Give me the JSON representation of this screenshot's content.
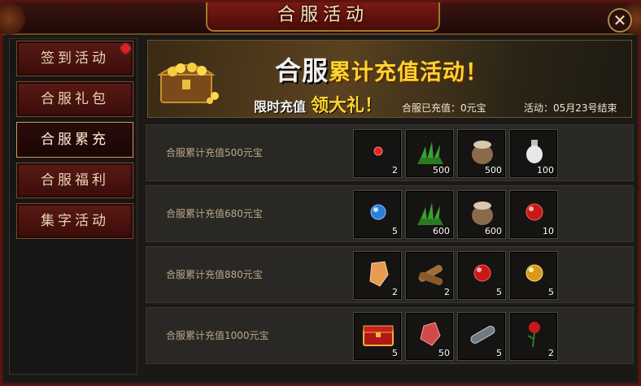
{
  "window": {
    "title": "合服活动",
    "close_label": "✕"
  },
  "sidebar": {
    "items": [
      {
        "label": "签到活动",
        "has_notice": true,
        "active": false
      },
      {
        "label": "合服礼包",
        "has_notice": false,
        "active": false
      },
      {
        "label": "合服累充",
        "has_notice": false,
        "active": true
      },
      {
        "label": "合服福利",
        "has_notice": false,
        "active": false
      },
      {
        "label": "集字活动",
        "has_notice": false,
        "active": false
      }
    ]
  },
  "banner": {
    "title_part1": "合服",
    "title_part2": "累计充值活动！",
    "subtitle_part1": "限时充值",
    "subtitle_part2": "领大礼！",
    "recharged_text": "合服已充值：0元宝",
    "end_text": "活动：05月23号结束"
  },
  "tiers": [
    {
      "label": "合服累计充值500元宝",
      "rewards": [
        {
          "icon": "red-gem-icon",
          "qty": "2"
        },
        {
          "icon": "herb-icon",
          "qty": "500"
        },
        {
          "icon": "sack-icon",
          "qty": "500"
        },
        {
          "icon": "white-potion-icon",
          "qty": "100"
        }
      ]
    },
    {
      "label": "合服累计充值680元宝",
      "rewards": [
        {
          "icon": "blue-orb-icon",
          "qty": "5"
        },
        {
          "icon": "herb-icon",
          "qty": "600"
        },
        {
          "icon": "sack-icon",
          "qty": "600"
        },
        {
          "icon": "red-orb-icon",
          "qty": "10"
        }
      ]
    },
    {
      "label": "合服累计充值880元宝",
      "rewards": [
        {
          "icon": "amber-crystal-icon",
          "qty": "2"
        },
        {
          "icon": "scroll-bundle-icon",
          "qty": "2"
        },
        {
          "icon": "red-orb-icon",
          "qty": "5"
        },
        {
          "icon": "gold-orb-icon",
          "qty": "5"
        }
      ]
    },
    {
      "label": "合服累计充值1000元宝",
      "rewards": [
        {
          "icon": "red-chest-icon",
          "qty": "5"
        },
        {
          "icon": "red-crystal-icon",
          "qty": "50"
        },
        {
          "icon": "scroll-icon",
          "qty": "5"
        },
        {
          "icon": "rose-icon",
          "qty": "2"
        }
      ]
    }
  ]
}
